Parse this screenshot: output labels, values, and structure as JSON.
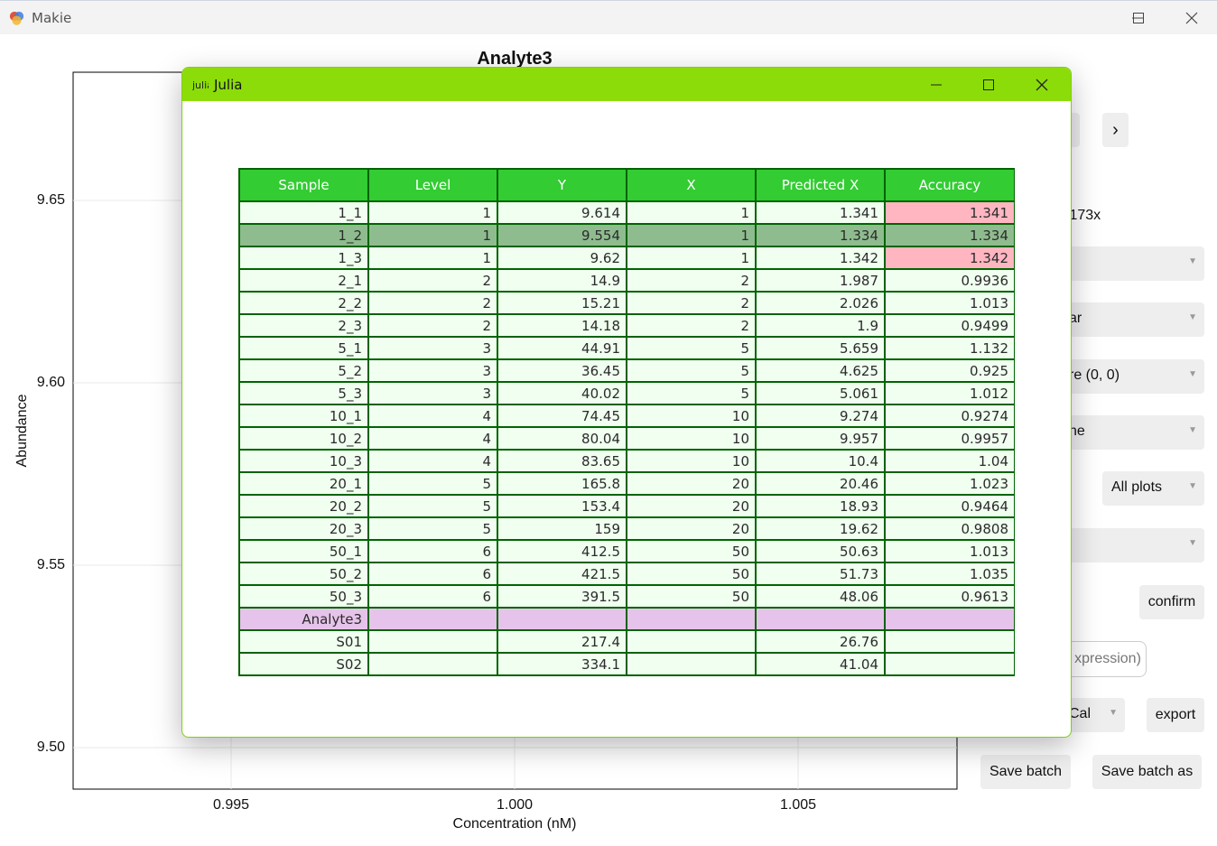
{
  "makie_window": {
    "title": "Makie",
    "plot_title": "Analyte3",
    "y_axis_label": "Abundance",
    "x_axis_label": "Concentration (nM)",
    "y_ticks": [
      "9.65",
      "9.60",
      "9.55",
      "9.50"
    ],
    "x_ticks": [
      "0.995",
      "1.000",
      "1.005"
    ]
  },
  "right_panel": {
    "nav_next": "›",
    "formula_fragment": ".173x",
    "menus": [
      {
        "text": ""
      },
      {
        "text": "ar"
      },
      {
        "text": "re (0, 0)"
      },
      {
        "text": "ne"
      },
      {
        "text": "All plots"
      },
      {
        "text": ""
      }
    ],
    "confirm_label": "confirm",
    "expression_fragment": "xpression)",
    "cal_menu": "Cal",
    "export_label": "export",
    "save_batch_label": "Save batch",
    "save_batch_as_label": "Save batch as"
  },
  "julia_window": {
    "title": "Julia",
    "icon_text": "julia",
    "table": {
      "columns": [
        "Sample",
        "Level",
        "Y",
        "X",
        "Predicted X",
        "Accuracy"
      ],
      "rows": [
        {
          "sample": "1_1",
          "level": "1",
          "y": "9.614",
          "x": "1",
          "predicted": "1.341",
          "accuracy": "1.341",
          "flag": "bad"
        },
        {
          "sample": "1_2",
          "level": "1",
          "y": "9.554",
          "x": "1",
          "predicted": "1.334",
          "accuracy": "1.334",
          "flag": "selected"
        },
        {
          "sample": "1_3",
          "level": "1",
          "y": "9.62",
          "x": "1",
          "predicted": "1.342",
          "accuracy": "1.342",
          "flag": "bad"
        },
        {
          "sample": "2_1",
          "level": "2",
          "y": "14.9",
          "x": "2",
          "predicted": "1.987",
          "accuracy": "0.9936",
          "flag": ""
        },
        {
          "sample": "2_2",
          "level": "2",
          "y": "15.21",
          "x": "2",
          "predicted": "2.026",
          "accuracy": "1.013",
          "flag": ""
        },
        {
          "sample": "2_3",
          "level": "2",
          "y": "14.18",
          "x": "2",
          "predicted": "1.9",
          "accuracy": "0.9499",
          "flag": ""
        },
        {
          "sample": "5_1",
          "level": "3",
          "y": "44.91",
          "x": "5",
          "predicted": "5.659",
          "accuracy": "1.132",
          "flag": ""
        },
        {
          "sample": "5_2",
          "level": "3",
          "y": "36.45",
          "x": "5",
          "predicted": "4.625",
          "accuracy": "0.925",
          "flag": ""
        },
        {
          "sample": "5_3",
          "level": "3",
          "y": "40.02",
          "x": "5",
          "predicted": "5.061",
          "accuracy": "1.012",
          "flag": ""
        },
        {
          "sample": "10_1",
          "level": "4",
          "y": "74.45",
          "x": "10",
          "predicted": "9.274",
          "accuracy": "0.9274",
          "flag": ""
        },
        {
          "sample": "10_2",
          "level": "4",
          "y": "80.04",
          "x": "10",
          "predicted": "9.957",
          "accuracy": "0.9957",
          "flag": ""
        },
        {
          "sample": "10_3",
          "level": "4",
          "y": "83.65",
          "x": "10",
          "predicted": "10.4",
          "accuracy": "1.04",
          "flag": ""
        },
        {
          "sample": "20_1",
          "level": "5",
          "y": "165.8",
          "x": "20",
          "predicted": "20.46",
          "accuracy": "1.023",
          "flag": ""
        },
        {
          "sample": "20_2",
          "level": "5",
          "y": "153.4",
          "x": "20",
          "predicted": "18.93",
          "accuracy": "0.9464",
          "flag": ""
        },
        {
          "sample": "20_3",
          "level": "5",
          "y": "159",
          "x": "20",
          "predicted": "19.62",
          "accuracy": "0.9808",
          "flag": ""
        },
        {
          "sample": "50_1",
          "level": "6",
          "y": "412.5",
          "x": "50",
          "predicted": "50.63",
          "accuracy": "1.013",
          "flag": ""
        },
        {
          "sample": "50_2",
          "level": "6",
          "y": "421.5",
          "x": "50",
          "predicted": "51.73",
          "accuracy": "1.035",
          "flag": ""
        },
        {
          "sample": "50_3",
          "level": "6",
          "y": "391.5",
          "x": "50",
          "predicted": "48.06",
          "accuracy": "0.9613",
          "flag": ""
        },
        {
          "sample": "Analyte3",
          "level": "",
          "y": "",
          "x": "",
          "predicted": "",
          "accuracy": "",
          "flag": "analyte"
        },
        {
          "sample": "S01",
          "level": "",
          "y": "217.4",
          "x": "",
          "predicted": "26.76",
          "accuracy": "",
          "flag": ""
        },
        {
          "sample": "S02",
          "level": "",
          "y": "334.1",
          "x": "",
          "predicted": "41.04",
          "accuracy": "",
          "flag": ""
        }
      ]
    }
  },
  "colors": {
    "julia_titlebar": "#8cdc0a",
    "table_header": "#33cc33",
    "table_border": "#006400",
    "row_bg": "#f0fff0",
    "selected_row": "#8fbc8f",
    "flag_bad": "#ffb6c1",
    "analyte_row": "#e6c3ea"
  }
}
